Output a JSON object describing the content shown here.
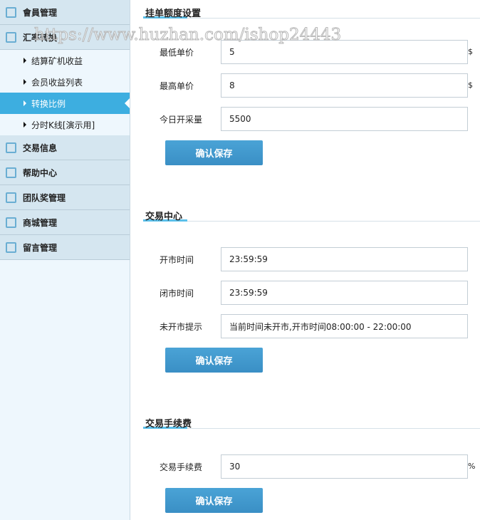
{
  "sidebar": {
    "items": [
      {
        "label": "會員管理",
        "icon": "list-icon"
      },
      {
        "label": "汇率转换",
        "icon": "chat-icon"
      },
      {
        "label": "交易信息",
        "icon": "list-icon"
      },
      {
        "label": "帮助中心",
        "icon": "edit-icon"
      },
      {
        "label": "团队奖管理",
        "icon": "calendar-icon"
      },
      {
        "label": "商城管理",
        "icon": "calendar-icon"
      },
      {
        "label": "留言管理",
        "icon": "edit-icon"
      }
    ],
    "sub_items": [
      {
        "label": "结算矿机收益"
      },
      {
        "label": "会员收益列表"
      },
      {
        "label": "转换比例",
        "active": true
      },
      {
        "label": "分时K线[演示用]"
      }
    ],
    "active_color": "#3daee0"
  },
  "sections": [
    {
      "title": "挂单额度设置",
      "fields": [
        {
          "label": "最低单价",
          "value": "5",
          "unit": "$"
        },
        {
          "label": "最高单价",
          "value": "8",
          "unit": "$"
        },
        {
          "label": "今日开采量",
          "value": "5500"
        }
      ],
      "button": "确认保存"
    },
    {
      "title": "交易中心",
      "fields": [
        {
          "label": "开市时间",
          "value": "23:59:59"
        },
        {
          "label": "闭市时间",
          "value": "23:59:59"
        },
        {
          "label": "未开市提示",
          "value": "当前时间未开市,开市时间08:00:00 - 22:00:00"
        }
      ],
      "button": "确认保存"
    },
    {
      "title": "交易手续费",
      "fields": [
        {
          "label": "交易手续费",
          "value": "30",
          "unit": "%"
        }
      ],
      "button": "确认保存"
    }
  ],
  "watermark": "https://www.huzhan.com/ishop24443"
}
